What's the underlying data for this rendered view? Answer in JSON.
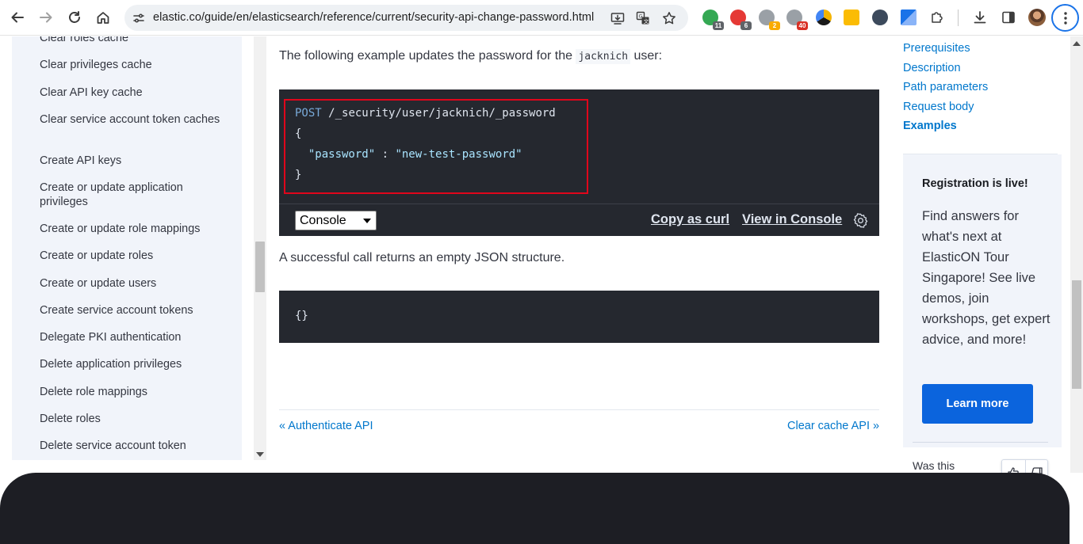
{
  "browser": {
    "url": "elastic.co/guide/en/elasticsearch/reference/current/security-api-change-password.html",
    "extensions": [
      {
        "name": "green-extension-icon",
        "color": "#34a853",
        "badge": "11",
        "badge_color": "#5f6368"
      },
      {
        "name": "red-extension-icon",
        "color": "#e53935",
        "badge": "6",
        "badge_color": "#5f6368"
      },
      {
        "name": "gray-extension-icon",
        "color": "#9aa0a6",
        "badge": "2",
        "badge_color": "#f9ab00"
      },
      {
        "name": "dark-extension-icon",
        "color": "#9aa0a6",
        "badge": "40",
        "badge_color": "#d93025"
      }
    ]
  },
  "sidebar": {
    "items": [
      "Clear roles cache",
      "Clear privileges cache",
      "Clear API key cache",
      "Clear service account token caches",
      "Create API keys",
      "Create or update application privileges",
      "Create or update role mappings",
      "Create or update roles",
      "Create or update users",
      "Create service account tokens",
      "Delegate PKI authentication",
      "Delete application privileges",
      "Delete role mappings",
      "Delete roles",
      "Delete service account token"
    ]
  },
  "main": {
    "intro_before": "The following example updates the password for the ",
    "intro_code": "jacknich",
    "intro_after": " user:",
    "request": {
      "method": "POST",
      "path": "/_security/user/jacknich/_password",
      "open_brace": "{",
      "key": "\"password\"",
      "colon": " : ",
      "value": "\"new-test-password\"",
      "close_brace": "}"
    },
    "console_select": "Console",
    "copy_as_curl": "Copy as curl",
    "view_in_console": "View in Console",
    "result_text": "A successful call returns an empty JSON structure.",
    "response": "{}",
    "prev_link": "« Authenticate API",
    "next_link": "Clear cache API »"
  },
  "toc": {
    "items": [
      "Prerequisites",
      "Description",
      "Path parameters",
      "Request body",
      "Examples"
    ],
    "active": "Examples"
  },
  "promo": {
    "title": "Registration is live!",
    "body": "Find answers for what's next at ElasticON Tour Singapore! See live demos, join workshops, get expert advice, and more!",
    "button": "Learn more"
  },
  "feedback": {
    "label": "Was this"
  }
}
